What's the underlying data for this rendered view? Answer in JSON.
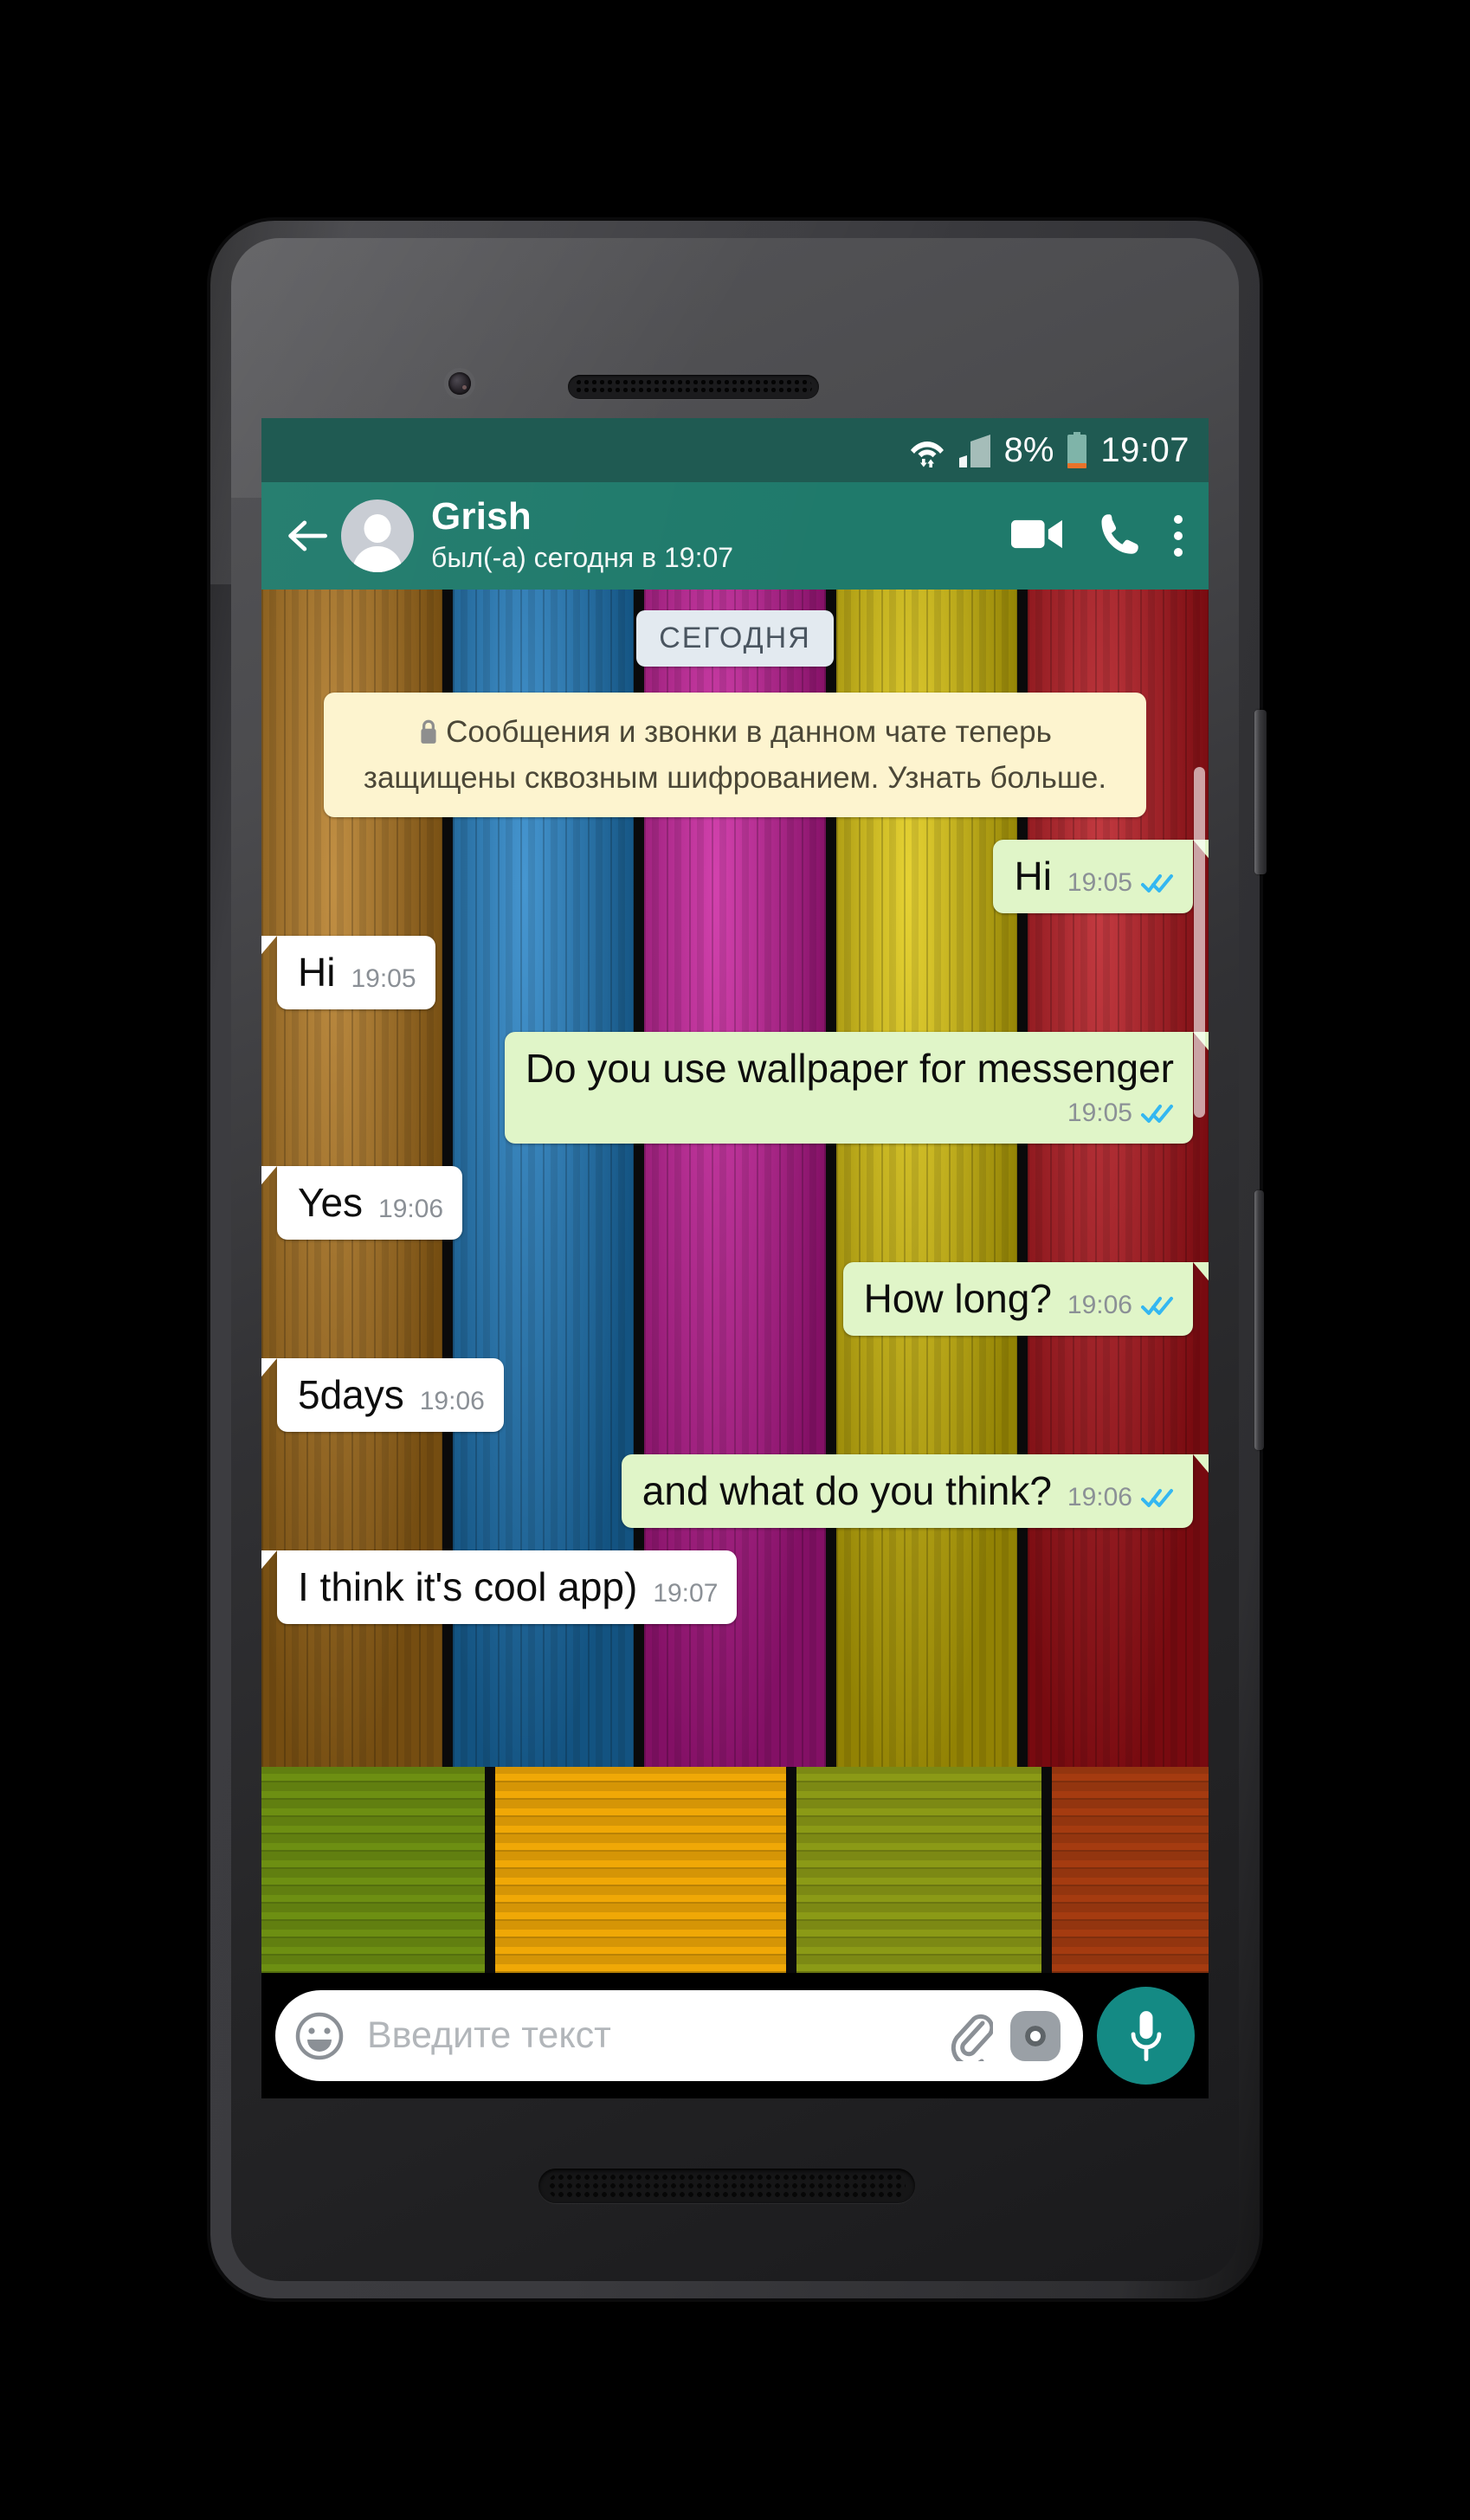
{
  "device": {
    "name": "android-smartphone",
    "body_color": "#3a3a3e"
  },
  "status_bar": {
    "background": "#1f5a52",
    "wifi_icon": "wifi-icon",
    "signal_icon": "cellular-signal-icon",
    "battery_percent": "8%",
    "battery_icon": "battery-low-icon",
    "battery_level_color": "#e8732a",
    "time": "19:07"
  },
  "app_bar": {
    "background": "#1f7a6b",
    "back_icon": "back-arrow-icon",
    "avatar_icon": "contact-avatar-icon",
    "contact_name": "Grish",
    "last_seen": "был(-а) сегодня в 19:07",
    "video_call_icon": "video-camera-icon",
    "voice_call_icon": "phone-icon",
    "overflow_icon": "more-vertical-icon"
  },
  "chat": {
    "day_divider": "СЕГОДНЯ",
    "encryption_notice": {
      "lock_icon": "lock-icon",
      "text": "Сообщения и звонки в данном чате теперь защищены сквозным шифрованием. Узнать больше."
    },
    "bubble_colors": {
      "outgoing": "#e0f5c8",
      "incoming": "#ffffff",
      "tick_read": "#34b7f1"
    },
    "messages": [
      {
        "direction": "out",
        "text": "Hi",
        "time": "19:05",
        "status": "read"
      },
      {
        "direction": "in",
        "text": "Hi",
        "time": "19:05",
        "status": ""
      },
      {
        "direction": "out",
        "text": "Do you use wallpaper for messenger",
        "time": "19:05",
        "status": "read"
      },
      {
        "direction": "in",
        "text": "Yes",
        "time": "19:06",
        "status": ""
      },
      {
        "direction": "out",
        "text": "How long?",
        "time": "19:06",
        "status": "read"
      },
      {
        "direction": "in",
        "text": "5days",
        "time": "19:06",
        "status": ""
      },
      {
        "direction": "out",
        "text": "and what do you think?",
        "time": "19:06",
        "status": "read"
      },
      {
        "direction": "in",
        "text": "I think it's cool app)",
        "time": "19:07",
        "status": ""
      }
    ],
    "wallpaper": {
      "name": "colored-wooden-planks-wallpaper",
      "plank_colors": [
        "#b3761a",
        "#1d7fc6",
        "#c9189b",
        "#e0c806",
        "#b81018"
      ],
      "floor_colors": [
        "#6d8f12",
        "#f0a806",
        "#8b9a16",
        "#a53b10"
      ]
    },
    "scrollbar": "chat-scrollbar"
  },
  "input_bar": {
    "emoji_icon": "smiley-icon",
    "placeholder": "Введите текст",
    "attach_icon": "paperclip-icon",
    "camera_icon": "camera-icon",
    "mic_icon": "microphone-icon",
    "mic_button_color": "#148a84"
  }
}
